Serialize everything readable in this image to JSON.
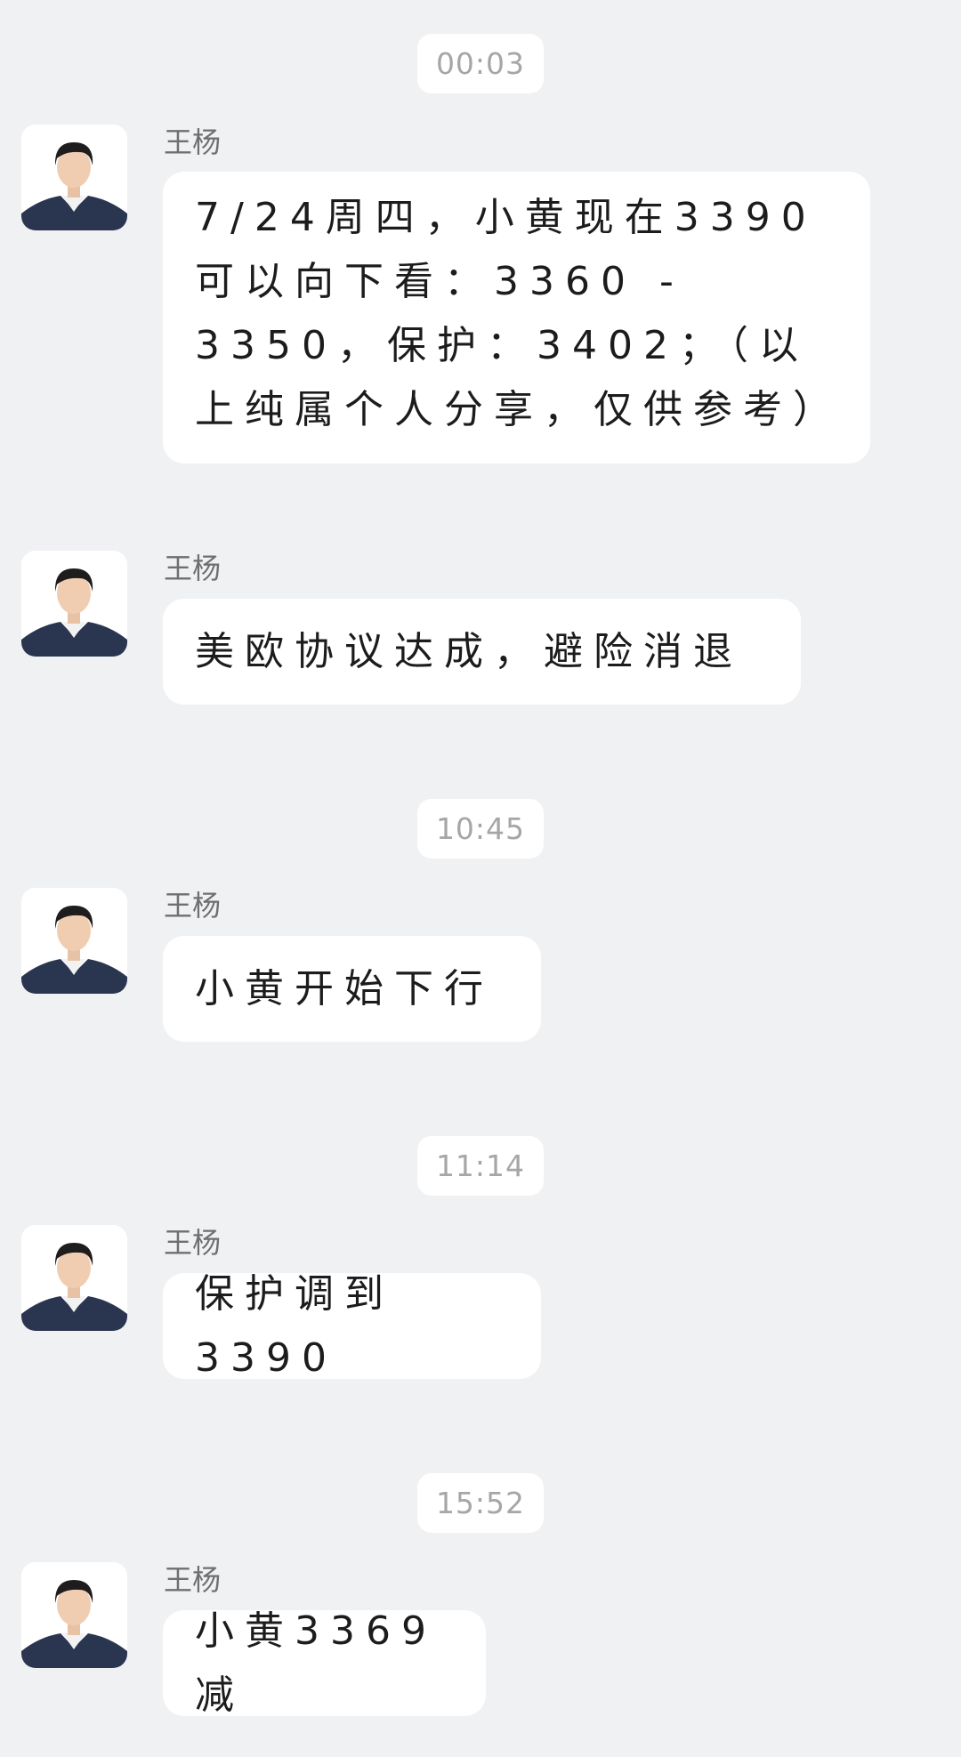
{
  "timestamps": [
    "00:03",
    "10:45",
    "11:14",
    "15:52"
  ],
  "messages": [
    {
      "sender": "王杨",
      "text": "7/24周四，小黄现在3390可以向下看：3360 - 3350，保护：3402；（以上纯属个人分享，仅供参考）"
    },
    {
      "sender": "王杨",
      "text": "美欧协议达成，避险消退"
    },
    {
      "sender": "王杨",
      "text": "小黄开始下行"
    },
    {
      "sender": "王杨",
      "text": "保护调到3390"
    },
    {
      "sender": "王杨",
      "text": "小黄3369减"
    }
  ],
  "icons": {
    "avatar": "avatar-portrait-icon"
  },
  "colors": {
    "background": "#f0f1f3",
    "bubble": "#ffffff",
    "timestamp_text": "#a6a6a6",
    "sender_text": "#6f6f6f",
    "message_text": "#1c1c1c"
  }
}
